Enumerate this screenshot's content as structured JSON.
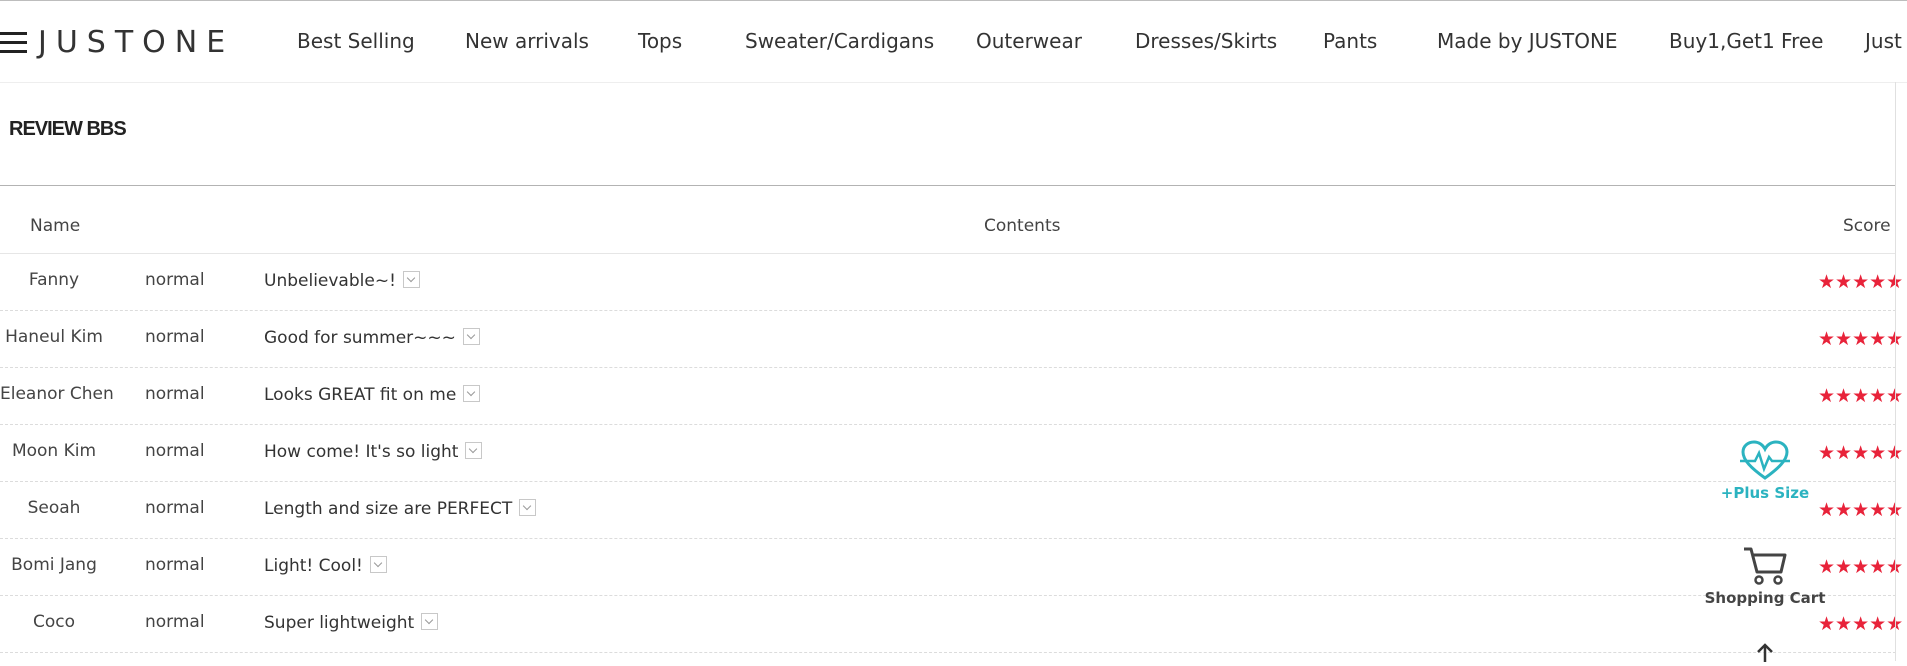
{
  "brand": {
    "logo": "JUSTONE"
  },
  "nav": [
    "Best Selling",
    "New arrivals",
    "Tops",
    "Sweater/Cardigans",
    "Outerwear",
    "Dresses/Skirts",
    "Pants",
    "Made by JUSTONE",
    "Buy1,Get1 Free",
    "Just"
  ],
  "page": {
    "title": "REVIEW BBS"
  },
  "table": {
    "headers": {
      "name": "Name",
      "contents": "Contents",
      "score": "Score"
    },
    "rows": [
      {
        "name": "Fanny",
        "type": "normal",
        "content": "Unbelievable~!",
        "stars": "★★★★★"
      },
      {
        "name": "Haneul Kim",
        "type": "normal",
        "content": "Good for summer~~~",
        "stars": "★★★★★"
      },
      {
        "name": "Eleanor Chen",
        "type": "normal",
        "content": "Looks GREAT fit on me",
        "stars": "★★★★★"
      },
      {
        "name": "Moon Kim",
        "type": "normal",
        "content": "How come! It's so light",
        "stars": "★★★★★"
      },
      {
        "name": "Seoah",
        "type": "normal",
        "content": "Length and size are PERFECT",
        "stars": "★★★★★"
      },
      {
        "name": "Bomi Jang",
        "type": "normal",
        "content": "Light! Cool!",
        "stars": "★★★★★"
      },
      {
        "name": "Coco",
        "type": "normal",
        "content": "Super lightweight",
        "stars": "★★★★★"
      }
    ]
  },
  "quick_menu": {
    "plus_size": "+Plus Size",
    "cart": "Shopping Cart"
  },
  "colors": {
    "star": "#e8233a",
    "plus_size": "#2bb3c0",
    "text": "#333333"
  },
  "icons": [
    "menu-icon",
    "heart-pulse-icon",
    "shopping-cart-icon",
    "arrow-up-icon",
    "chevron-down-icon",
    "star-icon"
  ]
}
